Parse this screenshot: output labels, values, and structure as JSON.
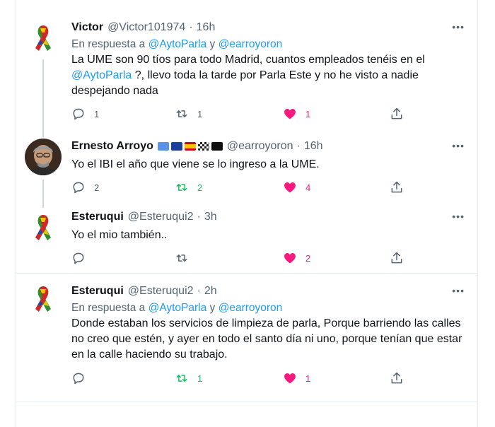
{
  "tweets": [
    {
      "name": "Victor",
      "handle": "@Victor101974",
      "time": "16h",
      "reply_prefix": "En respuesta a ",
      "reply_user1": "@AytoParla",
      "reply_and": " y ",
      "reply_user2": "@earroyoron",
      "text_part1": "La UME son 90 tíos para todo Madrid, cuantos empleados tenéis en el ",
      "text_mention": "@AytoParla",
      "text_part2": " ?, llevo toda la tarde por Parla Este y no he visto a nadie despejando nada",
      "replies": "1",
      "retweets": "1",
      "likes": "1",
      "more": "•••"
    },
    {
      "name": "Ernesto Arroyo",
      "handle": "@earroyoron",
      "time": "16h",
      "text": "Yo el IBI el año que viene se lo ingreso a la UME.",
      "replies": "2",
      "retweets": "2",
      "likes": "4",
      "more": "•••"
    },
    {
      "name": "Esteruqui",
      "handle": "@Esteruqui2",
      "time": "3h",
      "text": "Yo el mio también..",
      "replies": "",
      "retweets": "",
      "likes": "2",
      "more": "•••"
    },
    {
      "name": "Esteruqui",
      "handle": "@Esteruqui2",
      "time": "2h",
      "reply_prefix": "En respuesta a ",
      "reply_user1": "@AytoParla",
      "reply_and": " y ",
      "reply_user2": "@earroyoron",
      "text": "Donde estaban  los servicios de limpieza de parla, Porque barriendo las calles no creo que estén, y ayer en todo el santo día ni uno, porque tenían que estar en la calle haciendo su trabajo.",
      "replies": "",
      "retweets": "1",
      "likes": "1",
      "more": "•••"
    }
  ],
  "colors": {
    "link": "#1d9bf0",
    "retweet_active": "#17bf63",
    "like_active": "#f91880",
    "secondary": "#536471"
  },
  "icons": [
    "ribbon-avatar",
    "reply-icon",
    "retweet-icon",
    "heart-icon",
    "share-icon",
    "more-icon",
    "flag-emoji"
  ]
}
